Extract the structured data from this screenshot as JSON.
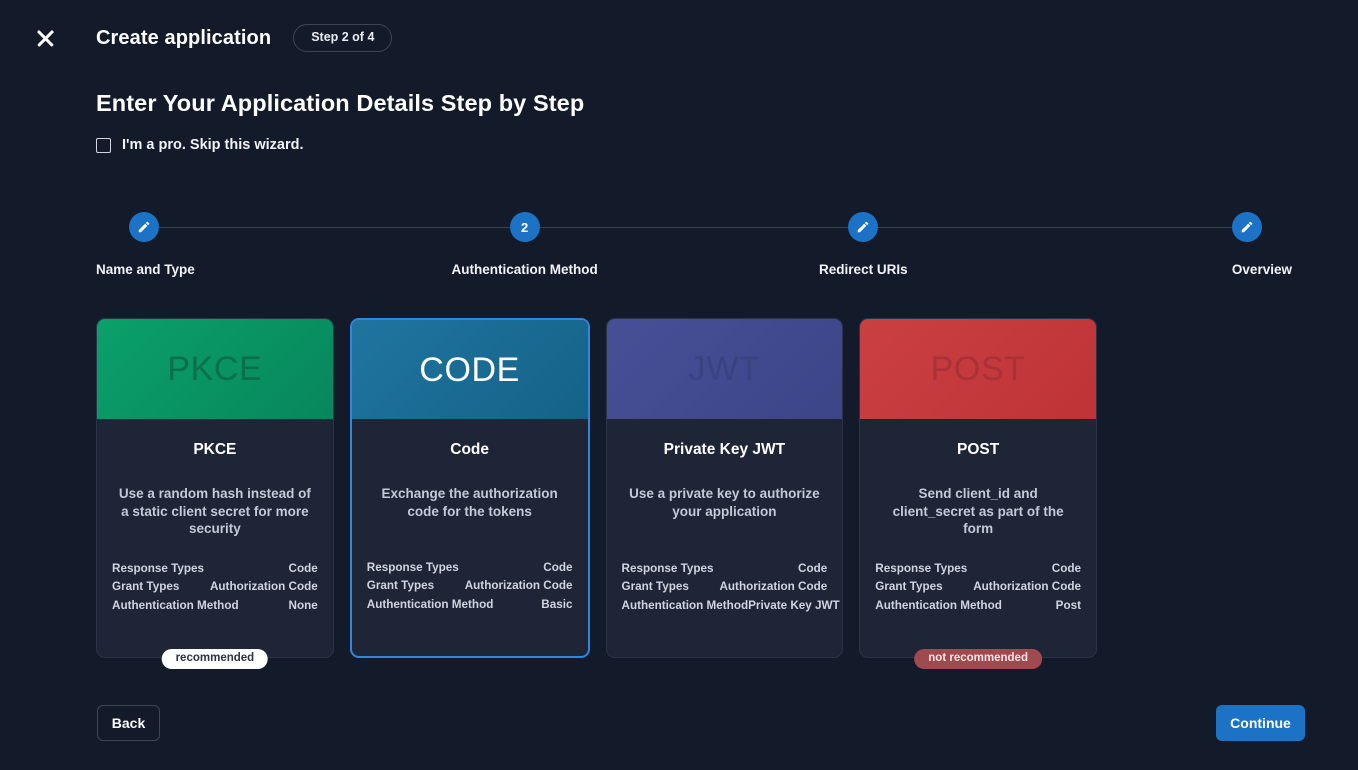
{
  "topbar": {
    "close_icon": "close-icon",
    "title": "Create application",
    "step_pill": "Step 2 of 4"
  },
  "heading": "Enter Your Application Details Step by Step",
  "pro_skip": {
    "label": "I'm a pro. Skip this wizard.",
    "checked": false
  },
  "stepper": {
    "steps": [
      {
        "label": "Name and Type",
        "marker": "pencil-icon",
        "state": "complete"
      },
      {
        "label": "Authentication Method",
        "marker": "2",
        "state": "current"
      },
      {
        "label": "Redirect URIs",
        "marker": "pencil-icon",
        "state": "complete"
      },
      {
        "label": "Overview",
        "marker": "pencil-icon",
        "state": "complete"
      }
    ]
  },
  "cards": [
    {
      "banner_text": "PKCE",
      "banner_color_from": "#0ba06a",
      "banner_color_to": "#07875c",
      "banner_text_color": "#0a6f4c",
      "title": "PKCE",
      "description": "Use a random hash instead of a static client secret for more security",
      "rows": [
        {
          "key": "Response Types",
          "value": "Code"
        },
        {
          "key": "Grant Types",
          "value": "Authorization Code"
        },
        {
          "key": "Authentication Method",
          "value": "None"
        }
      ],
      "badge": "recommended",
      "badge_type": "recommended",
      "selected": false
    },
    {
      "banner_text": "CODE",
      "banner_color_from": "#1f75a0",
      "banner_color_to": "#156288",
      "banner_text_color": "#ffffff",
      "title": "Code",
      "description": "Exchange the authorization code for the tokens",
      "rows": [
        {
          "key": "Response Types",
          "value": "Code"
        },
        {
          "key": "Grant Types",
          "value": "Authorization Code"
        },
        {
          "key": "Authentication Method",
          "value": "Basic"
        }
      ],
      "badge": "",
      "badge_type": "",
      "selected": true
    },
    {
      "banner_text": "JWT",
      "banner_color_from": "#474f96",
      "banner_color_to": "#3d4589",
      "banner_text_color": "#3a4280",
      "title": "Private Key JWT",
      "description": "Use a private key to authorize your application",
      "rows": [
        {
          "key": "Response Types",
          "value": "Code"
        },
        {
          "key": "Grant Types",
          "value": "Authorization Code"
        },
        {
          "key": "Authentication Method",
          "value": "Private Key JWT"
        }
      ],
      "badge": "",
      "badge_type": "",
      "selected": false
    },
    {
      "banner_text": "POST",
      "banner_color_from": "#c94043",
      "banner_color_to": "#bf3336",
      "banner_text_color": "#a83235",
      "title": "POST",
      "description": "Send client_id and client_secret as part of the form",
      "rows": [
        {
          "key": "Response Types",
          "value": "Code"
        },
        {
          "key": "Grant Types",
          "value": "Authorization Code"
        },
        {
          "key": "Authentication Method",
          "value": "Post"
        }
      ],
      "badge": "not recommended",
      "badge_type": "not-recommended",
      "selected": false
    }
  ],
  "footer": {
    "back_label": "Back",
    "continue_label": "Continue"
  },
  "colors": {
    "page_bg": "#131a29",
    "card_bg": "#1d2536",
    "accent": "#1c72c4",
    "selected_border": "#2f87e0"
  }
}
